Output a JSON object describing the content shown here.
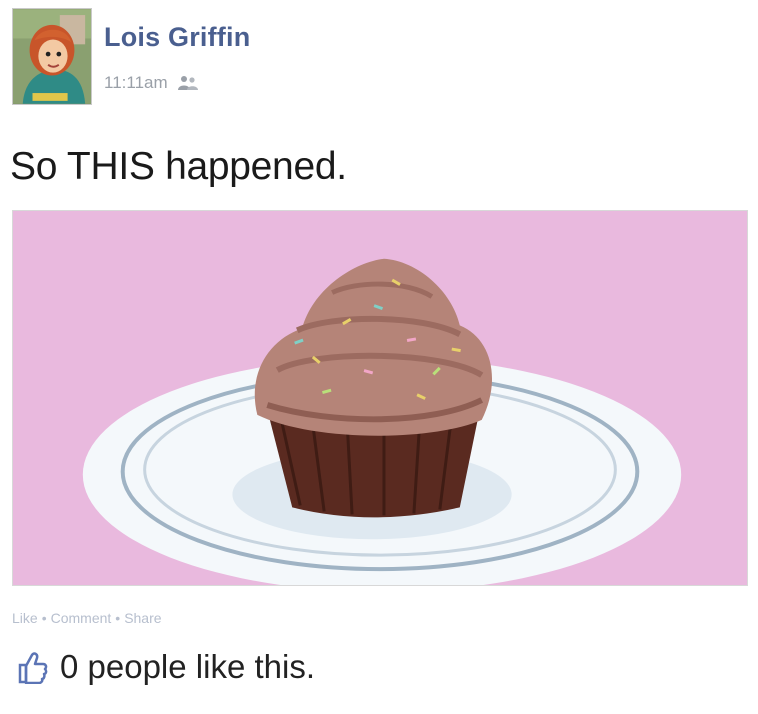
{
  "post": {
    "author": "Lois Griffin",
    "timestamp": "11:11am",
    "audience_icon": "people-icon",
    "status_text": "So THIS happened.",
    "photo_icon": "cupcake-photo",
    "actions": {
      "like": "Like",
      "comment": "Comment",
      "share": "Share",
      "separator": "•"
    },
    "like_summary": "0 people like this.",
    "like_icon": "thumbs-up-icon"
  },
  "colors": {
    "author_blue": "#4a5f8f",
    "photo_background": "#e9b9de",
    "muted_text": "#9aa0a8"
  }
}
